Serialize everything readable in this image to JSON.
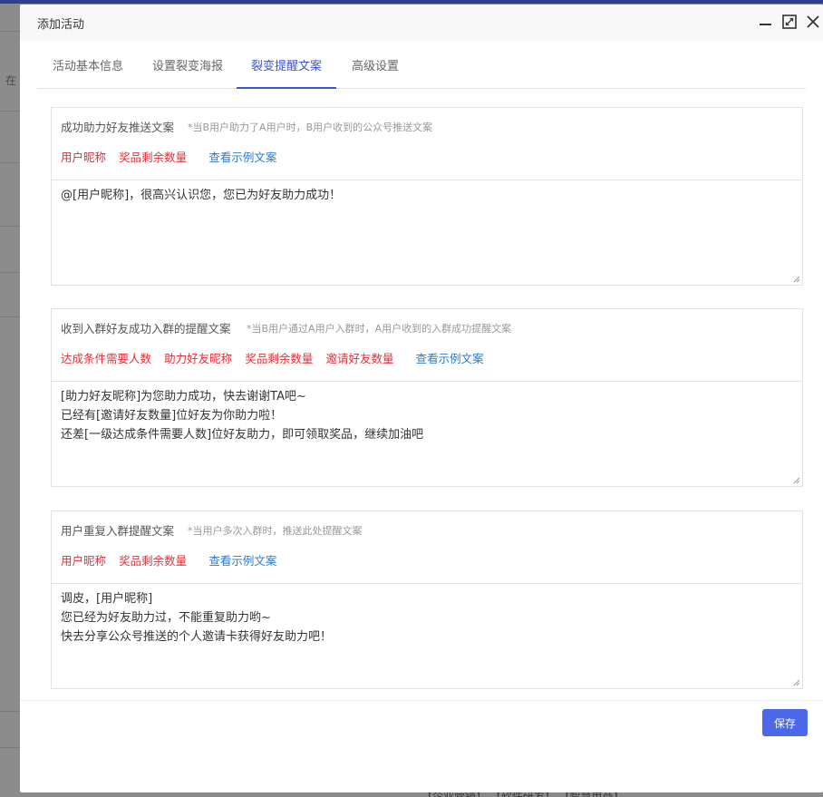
{
  "background": {
    "left_text": "在",
    "bottom_text": "【企业营销】 【软件研发】 【智慧电商】"
  },
  "modal": {
    "title": "添加活动"
  },
  "tabs": [
    {
      "label": "活动基本信息",
      "active": false
    },
    {
      "label": "设置裂变海报",
      "active": false
    },
    {
      "label": "裂变提醒文案",
      "active": true
    },
    {
      "label": "高级设置",
      "active": false
    }
  ],
  "sections": [
    {
      "title": "成功助力好友推送文案",
      "hint": "*当B用户助力了A用户时，B用户收到的公众号推送文案",
      "tags": [
        "用户昵称",
        "奖品剩余数量"
      ],
      "example_link": "查看示例文案",
      "text": "@[用户昵称]，很高兴认识您，您已为好友助力成功！"
    },
    {
      "title": "收到入群好友成功入群的提醒文案",
      "hint": "*当B用户通过A用户入群时，A用户收到的入群成功提醒文案",
      "tags": [
        "达成条件需要人数",
        "助力好友昵称",
        "奖品剩余数量",
        "邀请好友数量"
      ],
      "example_link": "查看示例文案",
      "text": "[助力好友昵称]为您助力成功，快去谢谢TA吧~\n已经有[邀请好友数量]位好友为你助力啦！\n还差[一级达成条件需要人数]位好友助力，即可领取奖品，继续加油吧"
    },
    {
      "title": "用户重复入群提醒文案",
      "hint": "*当用户多次入群时，推送此处提醒文案",
      "tags": [
        "用户昵称",
        "奖品剩余数量"
      ],
      "example_link": "查看示例文案",
      "text": "调皮，[用户昵称]\n您已经为好友助力过，不能重复助力哟~\n快去分享公众号推送的个人邀请卡获得好友助力吧！"
    }
  ],
  "footer": {
    "save_label": "保存",
    "accent_color": "#4a68e8"
  },
  "colors": {
    "tag": "#e0303a",
    "link": "#2a7ad0",
    "active_tab": "#3b54d6"
  }
}
